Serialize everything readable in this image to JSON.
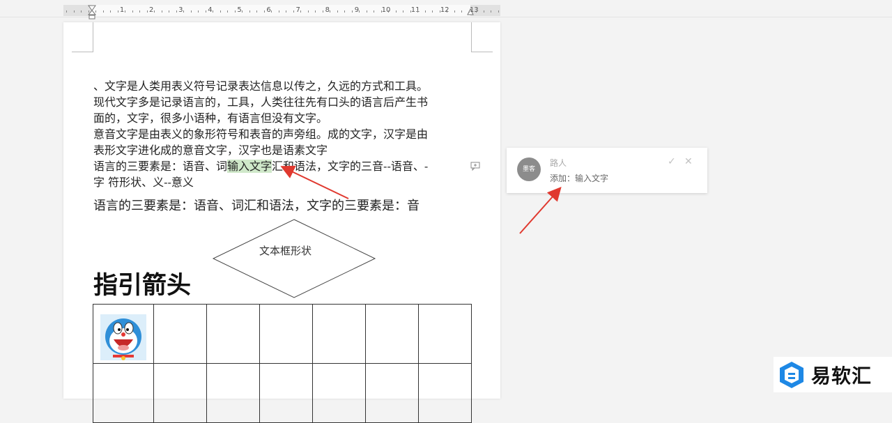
{
  "ruler": {
    "numbers": [
      "1",
      "2",
      "3",
      "4",
      "5",
      "6",
      "7",
      "8",
      "9",
      "10",
      "11",
      "12",
      "13"
    ]
  },
  "document": {
    "lines": [
      "、文字是人类用表义符号记录表达信息以传之，久远的方式和工具。",
      "现代文字多是记录语言的，工具，人类往往先有口头的语言后产生书",
      "面的，文字，很多小语种，有语言但没有文字。",
      "意音文字是由表义的象形符号和表音的声旁组。成的文字，汉字是由",
      "表形文字进化成的意音文字，汉字也是语素文字"
    ],
    "line6": {
      "before": "语言的三要素是：语音、词",
      "highlight": "输入文字",
      "after": "汇和语法，文字的三音--语音、-"
    },
    "line7": "字  符形状、义--意义",
    "line8": "语言的三要素是：语音、词汇和语法，文字的三要素是：音",
    "diamond_text": "文本框形状",
    "heading": "指引箭头"
  },
  "comment": {
    "avatar_text": "墨客",
    "author": "路人",
    "text": "添加：输入文字",
    "accept_icon": "check-icon",
    "reject_icon": "close-icon"
  },
  "watermark": {
    "text": "易软汇"
  },
  "colors": {
    "highlight": "#cfe8c9",
    "arrow": "#e0392f",
    "logo_blue": "#1e88e5"
  }
}
